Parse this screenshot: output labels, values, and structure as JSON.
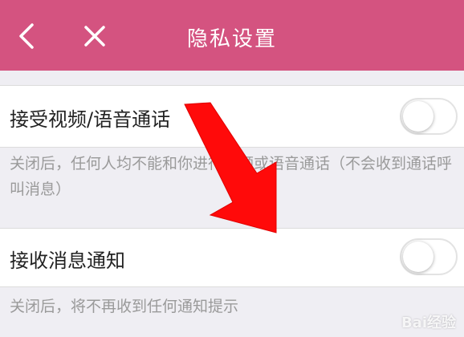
{
  "header": {
    "title": "隐私设置",
    "background": "#d45380",
    "back_icon": "chevron-left-icon",
    "close_icon": "close-icon"
  },
  "settings": [
    {
      "label": "接受视频/语音通话",
      "enabled": false,
      "description": "关闭后，任何人均不能和你进行视频或语音通话（不会收到通话呼叫消息）"
    },
    {
      "label": "接收消息通知",
      "enabled": false,
      "description": "关闭后，将不再收到任何通知提示"
    }
  ],
  "overlay": {
    "arrow_color": "#ff0a0a",
    "watermark": "Bai经验"
  }
}
